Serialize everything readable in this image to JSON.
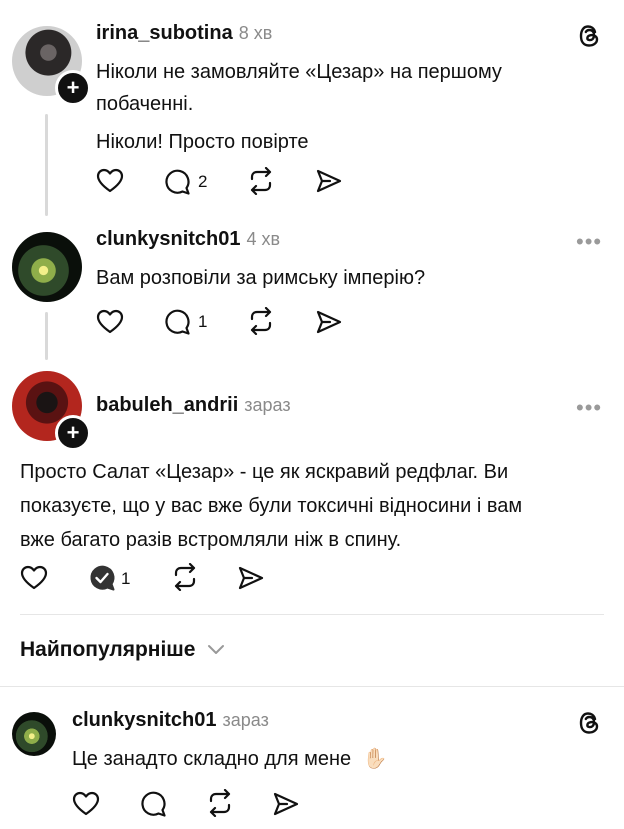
{
  "comments": [
    {
      "username": "irina_subotina",
      "time": "8 хв",
      "lines": [
        "Ніколи не замовляйте «Цезар» на першому",
        "побаченні.",
        "Ніколи! Просто повірте"
      ],
      "replies": "2"
    },
    {
      "username": "clunkysnitch01",
      "time": "4 хв",
      "lines": [
        "Вам розповіли за римську імперію?"
      ],
      "replies": "1"
    },
    {
      "username": "babuleh_andrii",
      "time": "зараз",
      "lines": [
        "Просто Салат «Цезар» - це як яскравий редфлаг. Ви",
        "показуєте,  що у вас вже були токсичні відносини і вам",
        "вже багато разів встромляли ніж в спину."
      ],
      "replies": "1"
    }
  ],
  "sort": {
    "label": "Найпопулярніше"
  },
  "reply": {
    "username": "clunkysnitch01",
    "time": "зараз",
    "text": "Це занадто складно для мене",
    "emoji": "✋🏻"
  },
  "more_label": "•••"
}
